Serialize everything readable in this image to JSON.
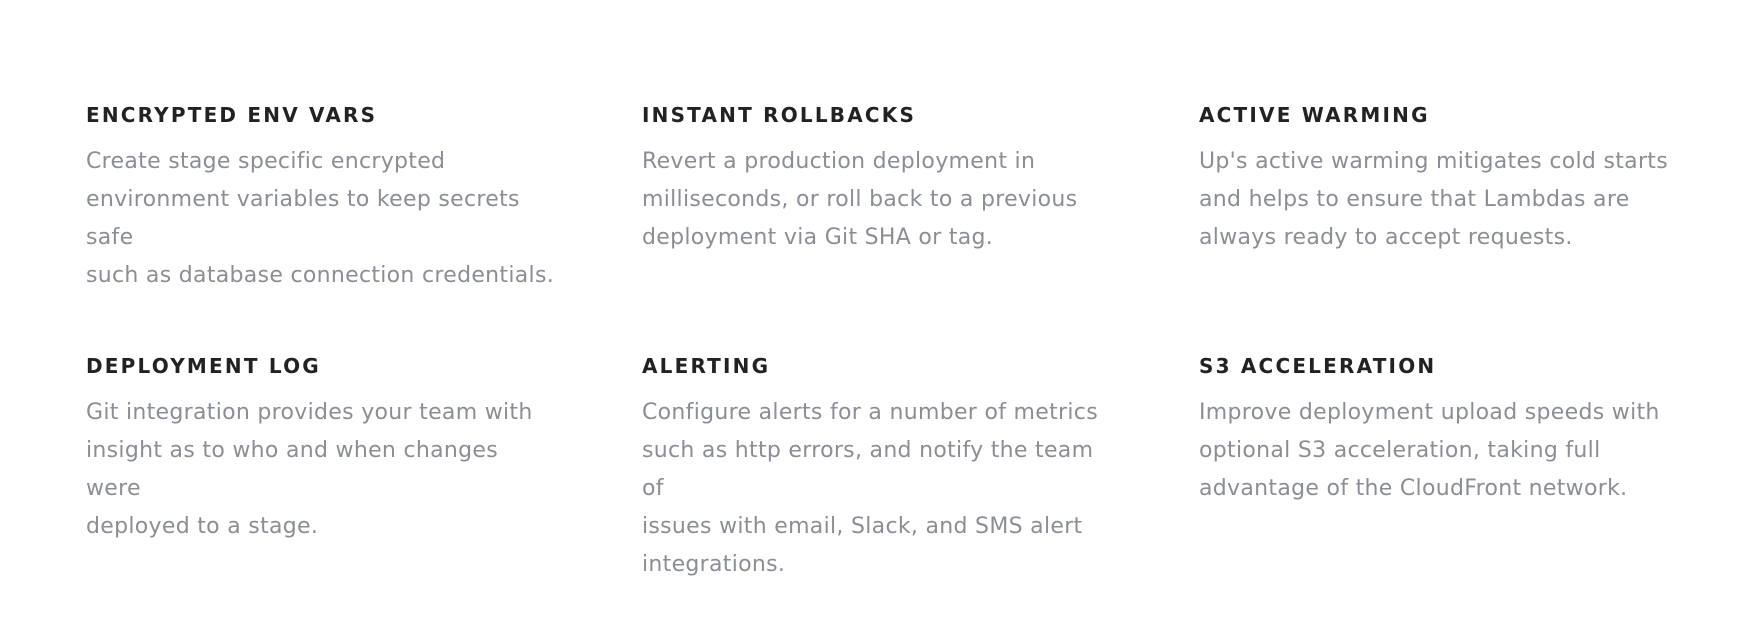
{
  "features": [
    {
      "title": "ENCRYPTED ENV VARS",
      "description": "Create stage specific encrypted\nenvironment variables to keep secrets safe\nsuch as database connection credentials."
    },
    {
      "title": "INSTANT ROLLBACKS",
      "description": "Revert a production deployment in\nmilliseconds, or roll back to a previous\ndeployment via Git SHA or tag."
    },
    {
      "title": "ACTIVE WARMING",
      "description": "Up's active warming mitigates cold starts\nand helps to ensure that Lambdas are\nalways ready to accept requests."
    },
    {
      "title": "DEPLOYMENT LOG",
      "description": "Git integration provides your team with\ninsight as to who and when changes were\ndeployed to a stage."
    },
    {
      "title": "ALERTING",
      "description": "Configure alerts for a number of metrics\nsuch as http errors, and notify the team of\nissues with email, Slack, and SMS alert\nintegrations."
    },
    {
      "title": "S3 ACCELERATION",
      "description": "Improve deployment upload speeds with\noptional S3 acceleration, taking full\nadvantage of the CloudFront network."
    }
  ],
  "colors": {
    "title": "#222222",
    "description": "#8b8e94",
    "background": "#ffffff"
  }
}
